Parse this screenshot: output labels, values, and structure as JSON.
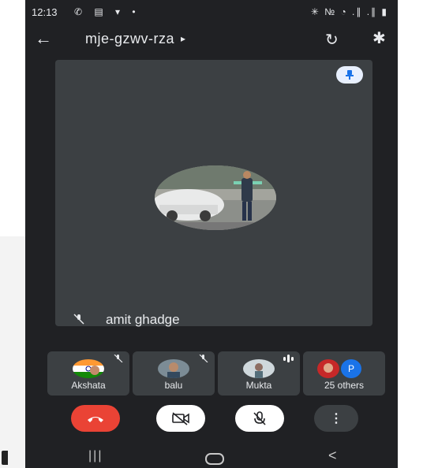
{
  "status_bar": {
    "time": "12:13",
    "notification_icons": "✆ ▤ ▾ •",
    "system_icons": "✳ № ◔ .∥ .∥ ▮"
  },
  "header": {
    "back_glyph": "←",
    "meeting_code": "mje-gzwv-rza",
    "caret": "▸",
    "switch_camera_glyph": "↻",
    "bluetooth_glyph": "✱"
  },
  "main_tile": {
    "name": "amit ghadge",
    "muted": true
  },
  "participants": [
    {
      "name": "Akshata",
      "muted": true
    },
    {
      "name": "balu",
      "muted": true
    },
    {
      "name": "Mukta",
      "speaking": true
    },
    {
      "name": "25 others",
      "initial": "P"
    }
  ],
  "controls": {
    "more_glyph": "⋮"
  },
  "navbar": {
    "recents": "|||",
    "back": "<"
  },
  "colors": {
    "background": "#202124",
    "tile": "#3c4043",
    "end_call": "#ea4335",
    "pin": "#1a73e8"
  }
}
